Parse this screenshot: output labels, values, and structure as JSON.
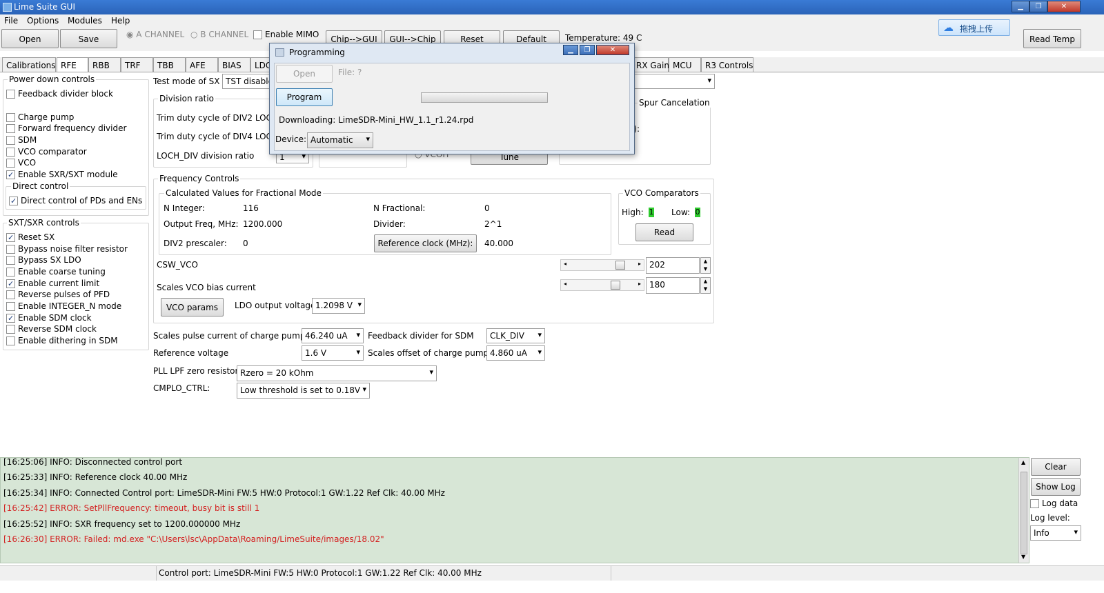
{
  "window": {
    "title": "Lime Suite GUI"
  },
  "menu": [
    "File",
    "Options",
    "Modules",
    "Help"
  ],
  "toolbar": {
    "open": "Open",
    "save": "Save",
    "a_channel": "A CHANNEL",
    "b_channel": "B CHANNEL",
    "enable_mimo": "Enable MIMO",
    "chip_to_gui": "Chip-->GUI",
    "gui_to_chip": "GUI-->Chip",
    "reset": "Reset",
    "default": "Default",
    "temperature": "Temperature: 49 C",
    "read_temp": "Read Temp",
    "cloud_upload": "拖拽上传"
  },
  "tabs": [
    "Calibrations",
    "RFE",
    "RBB",
    "TRF",
    "TBB",
    "AFE",
    "BIAS",
    "LDO",
    "RX Gain",
    "MCU",
    "R3 Controls"
  ],
  "power_down": {
    "title": "Power down controls",
    "items": [
      {
        "label": "Feedback divider block",
        "checked": false
      },
      {
        "label": "Charge pump",
        "checked": false
      },
      {
        "label": "Forward frequency divider",
        "checked": false
      },
      {
        "label": "SDM",
        "checked": false
      },
      {
        "label": "VCO comparator",
        "checked": false
      },
      {
        "label": "VCO",
        "checked": false
      },
      {
        "label": "Enable SXR/SXT module",
        "checked": true
      }
    ],
    "direct_title": "Direct control",
    "direct_item": {
      "label": "Direct control of PDs and ENs",
      "checked": true
    }
  },
  "sx_controls": {
    "title": "SXT/SXR controls",
    "items": [
      {
        "label": "Reset SX",
        "checked": true
      },
      {
        "label": "Bypass noise filter resistor",
        "checked": false
      },
      {
        "label": "Bypass SX LDO",
        "checked": false
      },
      {
        "label": "Enable coarse tuning",
        "checked": false
      },
      {
        "label": "Enable current limit",
        "checked": true
      },
      {
        "label": "Reverse pulses of PFD",
        "checked": false
      },
      {
        "label": "Enable INTEGER_N mode",
        "checked": false
      },
      {
        "label": "Enable SDM clock",
        "checked": true
      },
      {
        "label": "Reverse SDM clock",
        "checked": false
      },
      {
        "label": "Enable dithering in SDM",
        "checked": false
      }
    ]
  },
  "test_mode": {
    "label": "Test mode of SX",
    "value": "TST disable"
  },
  "division": {
    "title": "Division ratio",
    "trim2": "Trim duty cycle of DIV2 LOCH",
    "trim4": "Trim duty cycle of DIV4 LOCH",
    "loch": "LOCH_DIV division ratio",
    "loch_value": "1",
    "tune": "Tune",
    "vco_option": "VCOH"
  },
  "spur": {
    "title": "Spur Cancelation",
    "partial": "z):"
  },
  "freq": {
    "title": "Frequency Controls",
    "calc_title": "Calculated Values for Fractional Mode",
    "n_int_label": "N Integer:",
    "n_int": "116",
    "n_frac_label": "N Fractional:",
    "n_frac": "0",
    "out_label": "Output Freq, MHz:",
    "out": "1200.000",
    "div_label": "Divider:",
    "div": "2^1",
    "div2_label": "DIV2 prescaler:",
    "div2": "0",
    "ref_btn": "Reference clock (MHz):",
    "ref": "40.000",
    "vco_title": "VCO Comparators",
    "high_label": "High:",
    "high": "1",
    "low_label": "Low:",
    "low": "0",
    "read": "Read",
    "csw_label": "CSW_VCO",
    "csw": "202",
    "csw_slider": 0.79,
    "bias_label": "Scales VCO bias current",
    "bias": "180",
    "bias_slider": 0.71,
    "vco_params": "VCO params",
    "ldo_label": "LDO output voltage",
    "ldo": "1.2098 V"
  },
  "lower": {
    "pulse_label": "Scales pulse current of charge pump",
    "pulse": "46.240 uA",
    "fb_label": "Feedback divider for SDM",
    "fb": "CLK_DIV",
    "ref_label": "Reference voltage",
    "ref": "1.6 V",
    "offset_label": "Scales offset of charge pump",
    "offset": "4.860 uA",
    "lpf_label": "PLL LPF zero resistor:",
    "lpf": "Rzero = 20 kOhm",
    "cmplo_label": "CMPLO_CTRL:",
    "cmplo": "Low threshold is set to 0.18V"
  },
  "dialog": {
    "title": "Programming",
    "open": "Open",
    "file": "File: ?",
    "program": "Program",
    "progress": 0,
    "downloading": "Downloading: LimeSDR-Mini_HW_1.1_r1.24.rpd",
    "device_label": "Device:",
    "device": "Automatic"
  },
  "log": {
    "lines": [
      {
        "text": "[16:25:06] INFO: Disconnected control port",
        "level": "info"
      },
      {
        "text": "[16:25:33] INFO: Reference clock 40.00 MHz",
        "level": "info"
      },
      {
        "text": "[16:25:34] INFO: Connected Control port: LimeSDR-Mini FW:5 HW:0 Protocol:1 GW:1.22 Ref Clk: 40.00 MHz",
        "level": "info"
      },
      {
        "text": "[16:25:42] ERROR: SetPllFrequency: timeout, busy bit is still 1",
        "level": "error"
      },
      {
        "text": "[16:25:52] INFO: SXR frequency set to 1200.000000 MHz",
        "level": "info"
      },
      {
        "text": "[16:26:30] ERROR: Failed: md.exe \"C:\\Users\\lsc\\AppData\\Roaming/LimeSuite/images/18.02\"",
        "level": "error"
      }
    ],
    "clear": "Clear",
    "show_log": "Show Log",
    "log_data": "Log data",
    "level_label": "Log level:",
    "level": "Info"
  },
  "status": {
    "text": "Control port: LimeSDR-Mini FW:5 HW:0 Protocol:1 GW:1.22 Ref Clk: 40.00 MHz"
  }
}
